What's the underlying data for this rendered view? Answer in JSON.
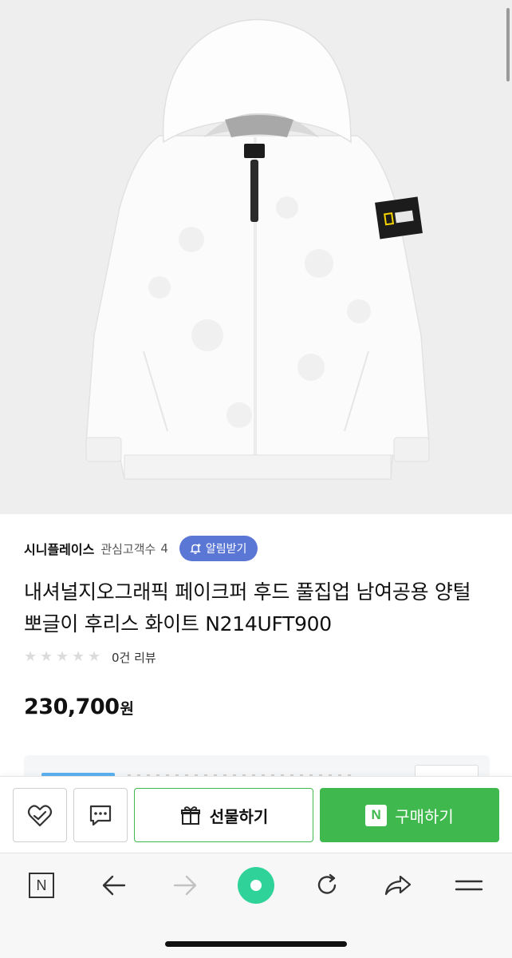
{
  "product": {
    "image_alt": "White fleece full-zip hoodie with National Geographic patch",
    "patch_text": "NATIONAL GEOGRAPHIC"
  },
  "seller": {
    "name": "시니플레이스",
    "interest_label": "관심고객수",
    "interest_count": "4",
    "notify_label": "알림받기"
  },
  "title": "내셔널지오그래픽 페이크퍼 후드 풀집업 남여공용 양털 뽀글이 후리스 화이트 N214UFT900",
  "reviews": {
    "rating": 0,
    "max": 5,
    "count_text": "0건 리뷰"
  },
  "price": {
    "value": "230,700",
    "unit": "원"
  },
  "purchase_bar": {
    "gift_label": "선물하기",
    "buy_label": "구매하기",
    "n_badge": "N"
  },
  "toolbar": {
    "home_label": "N"
  },
  "colors": {
    "accent_green": "#3fb94d",
    "notify_blue": "#5a77d6",
    "toolbar_green": "#2fd39a"
  },
  "icons": [
    "heart-check-icon",
    "chat-bubble-icon",
    "gift-icon",
    "naver-home-icon",
    "back-arrow-icon",
    "forward-arrow-icon",
    "green-dot-icon",
    "refresh-icon",
    "share-icon",
    "menu-icon"
  ]
}
